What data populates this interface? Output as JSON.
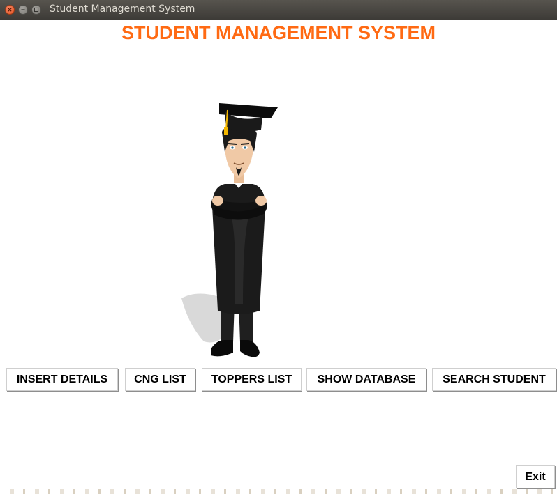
{
  "window": {
    "title": "Student Management System"
  },
  "header": {
    "title": "STUDENT MANAGEMENT SYSTEM",
    "color": "#ff6a13"
  },
  "illustration": {
    "icon": "graduate-student-illustration"
  },
  "menu": {
    "insert_details": "INSERT DETAILS",
    "cng_list": "CNG LIST",
    "toppers_list": "TOPPERS LIST",
    "show_database": "SHOW DATABASE",
    "search_student": "SEARCH STUDENT"
  },
  "footer": {
    "exit_label": "Exit"
  }
}
